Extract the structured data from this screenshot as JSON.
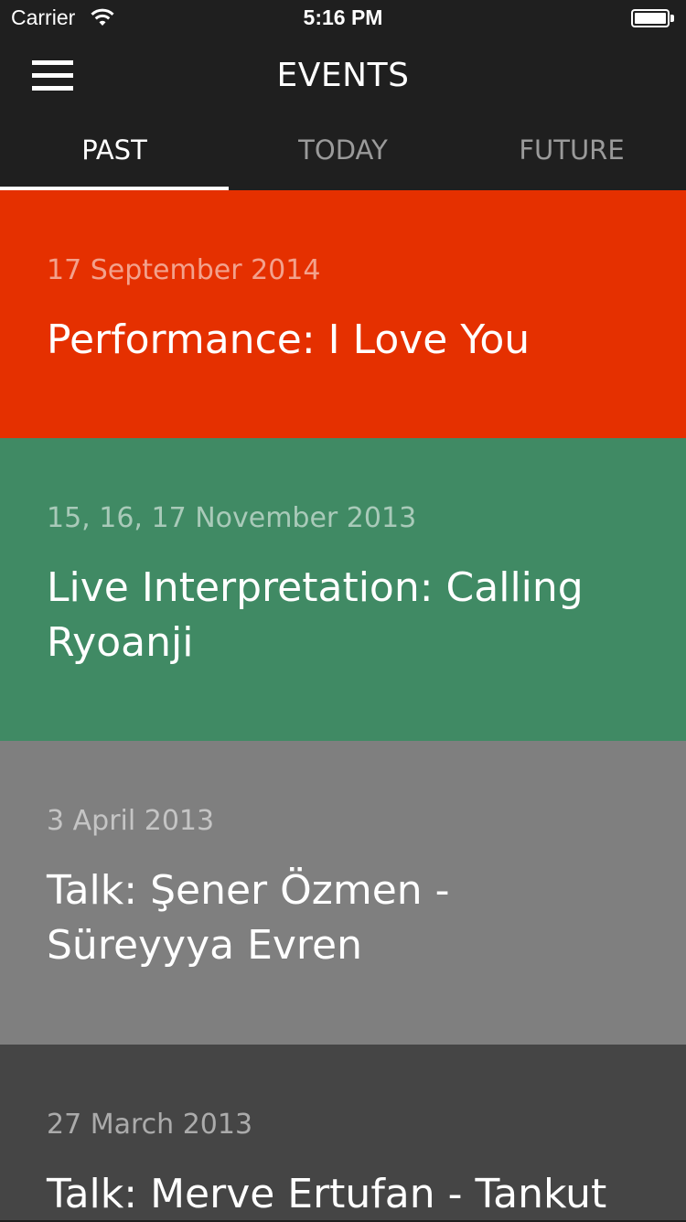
{
  "status_bar": {
    "carrier": "Carrier",
    "time": "5:16 PM",
    "wifi_icon": "wifi-icon",
    "battery_icon": "battery-icon"
  },
  "nav": {
    "title": "EVENTS",
    "menu_icon": "hamburger-menu-icon"
  },
  "tabs": [
    {
      "label": "PAST",
      "active": true
    },
    {
      "label": "TODAY",
      "active": false
    },
    {
      "label": "FUTURE",
      "active": false
    }
  ],
  "events": [
    {
      "date": "17 September 2014",
      "title": "Performance: I Love You",
      "color": "#e53000"
    },
    {
      "date": "15, 16, 17 November 2013",
      "title": "Live Interpretation: Calling Ryoanji",
      "color": "#408a64"
    },
    {
      "date": "3 April 2013",
      "title": "Talk: Şener Özmen - Süreyyya Evren",
      "color": "#7f7f7f"
    },
    {
      "date": "27 March 2013",
      "title": "Talk: Merve Ertufan - Tankut",
      "color": "#454545"
    }
  ],
  "colors": {
    "chrome": "#1f1f1f",
    "active_tab": "#ffffff",
    "inactive_tab": "#9a9a9a"
  }
}
